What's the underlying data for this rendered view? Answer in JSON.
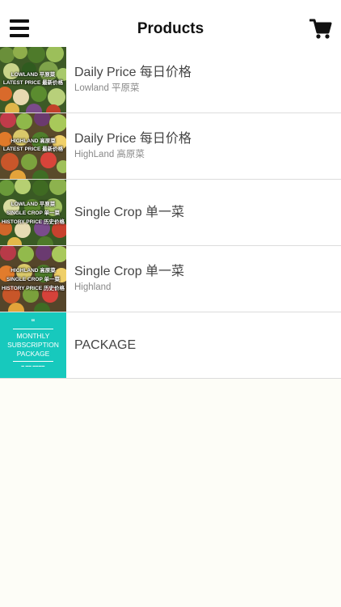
{
  "header": {
    "title": "Products"
  },
  "products": [
    {
      "title": "Daily Price 每日价格",
      "subtitle": "Lowland 平原菜",
      "thumb_lines": [
        "LOWLAND 平原菜",
        "LATEST PRICE 最新价格"
      ]
    },
    {
      "title": "Daily Price 每日价格",
      "subtitle": "HighLand 高原菜",
      "thumb_lines": [
        "HIGHLAND 高原菜",
        "LATEST PRICE 最新价格"
      ]
    },
    {
      "title": "Single Crop 单一菜",
      "subtitle": "",
      "thumb_lines": [
        "LOWLAND 平原菜",
        "SINGLE CROP 单一菜",
        "HISTORY PRICE 历史价格"
      ]
    },
    {
      "title": "Single Crop 单一菜",
      "subtitle": "Highland",
      "thumb_lines": [
        "HIGHLAND 高原菜",
        "SINGLE CROP 单一菜",
        "HISTORY PRICE 历史价格"
      ]
    },
    {
      "title": "PACKAGE",
      "subtitle": "",
      "thumb_lines": [
        "MONTHLY",
        "SUBSCRIPTION",
        "PACKAGE"
      ]
    }
  ],
  "colors": {
    "package_tile": "#17c9bd",
    "battery": "#4cd964"
  },
  "icons": {
    "menu": "hamburger-icon",
    "cart": "cart-icon"
  }
}
